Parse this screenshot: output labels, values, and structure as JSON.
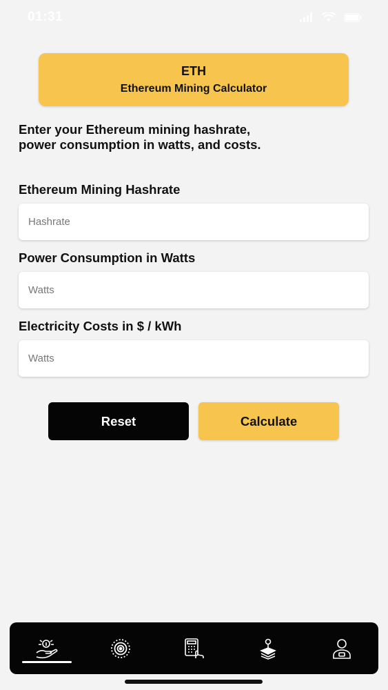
{
  "status_bar": {
    "time": "01:31"
  },
  "header": {
    "title": "ETH",
    "subtitle": "Ethereum Mining Calculator"
  },
  "intro_text": "Enter your Ethereum mining hashrate, power consumption in watts, and costs.",
  "fields": [
    {
      "label": "Ethereum Mining Hashrate",
      "placeholder": "Hashrate",
      "value": ""
    },
    {
      "label": "Power Consumption in Watts",
      "placeholder": "Watts",
      "value": ""
    },
    {
      "label": "Electricity Costs in $ / kWh",
      "placeholder": "Watts",
      "value": ""
    }
  ],
  "buttons": {
    "reset_label": "Reset",
    "calculate_label": "Calculate"
  },
  "tab_bar": {
    "tabs": [
      {
        "icon": "hand-coin-icon",
        "active": true
      },
      {
        "icon": "target-icon",
        "active": false
      },
      {
        "icon": "calculator-icon",
        "active": false
      },
      {
        "icon": "layers-pin-icon",
        "active": false
      },
      {
        "icon": "profile-icon",
        "active": false
      }
    ]
  },
  "colors": {
    "accent": "#f7c54e",
    "background": "#f3f3f3",
    "dark": "#050505"
  }
}
